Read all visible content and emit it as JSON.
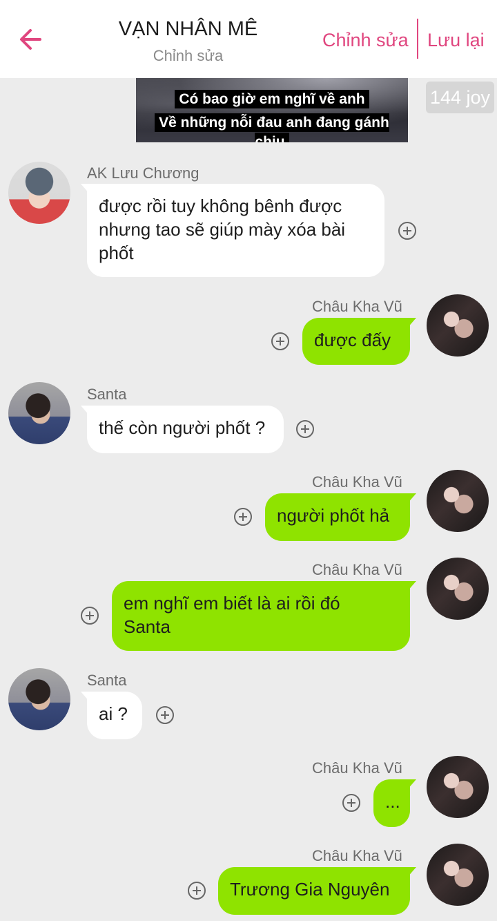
{
  "header": {
    "title": "VẠN NHÂN MÊ",
    "subtitle": "Chỉnh sửa",
    "edit_label": "Chỉnh sửa",
    "save_label": "Lưu lại",
    "accent_color": "#e0467f"
  },
  "image_caption": {
    "line1": "Có bao giờ em nghĩ về anh",
    "line2": "Về những nỗi đau anh đang gánh chịu"
  },
  "joy_badge": "144 joy",
  "messages": [
    {
      "sender": "AK Lưu Chương",
      "side": "left",
      "lines": [
        "được rồi tuy không bênh được",
        "nhưng tao sẽ giúp mày xóa bài",
        "phốt"
      ]
    },
    {
      "sender": "Châu Kha Vũ",
      "side": "right",
      "lines": [
        "được đấy"
      ]
    },
    {
      "sender": "Santa",
      "side": "left",
      "lines": [
        "thế còn người phốt ?"
      ]
    },
    {
      "sender": "Châu Kha Vũ",
      "side": "right",
      "lines": [
        "người phốt hả"
      ]
    },
    {
      "sender": "Châu Kha Vũ",
      "side": "right",
      "lines": [
        "em nghĩ em biết là ai rồi đó",
        "Santa"
      ]
    },
    {
      "sender": "Santa",
      "side": "left",
      "lines": [
        "ai ?"
      ]
    },
    {
      "sender": "Châu Kha Vũ",
      "side": "right",
      "lines": [
        "..."
      ]
    },
    {
      "sender": "Châu Kha Vũ",
      "side": "right",
      "lines": [
        "Trương Gia Nguyên"
      ]
    }
  ],
  "colors": {
    "outgoing_bubble": "#8fe300",
    "incoming_bubble": "#ffffff",
    "background": "#ececec"
  }
}
